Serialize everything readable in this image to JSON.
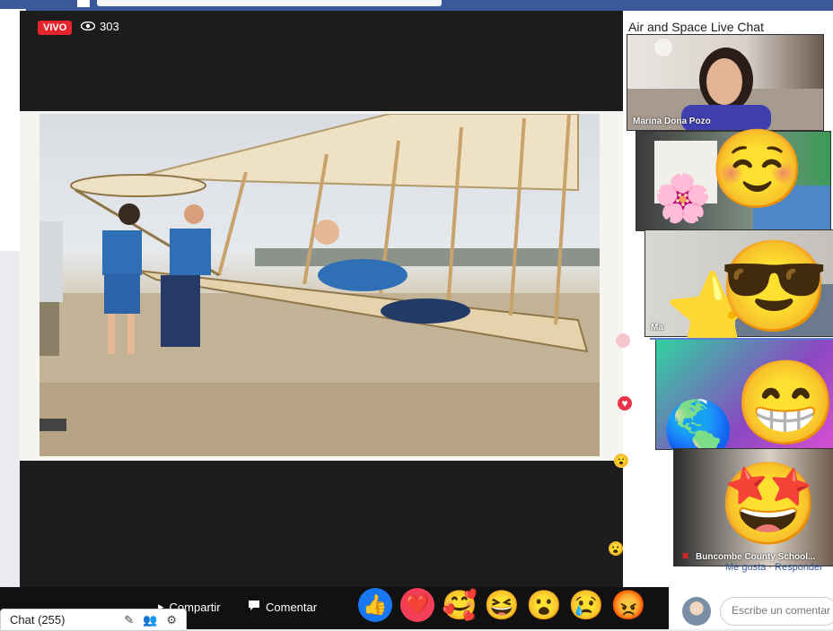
{
  "live": {
    "badge": "VIVO",
    "viewers": "303"
  },
  "chat": {
    "title": "Air and Space Live Chat",
    "participants": [
      {
        "name": "Marina Dona Pozo"
      },
      {
        "name": ""
      },
      {
        "name": "Ma"
      },
      {
        "name": ""
      },
      {
        "name": "Buncombe County School..."
      }
    ],
    "footer_links": "Me gusta · Responder"
  },
  "emojis": {
    "tile2": [
      "🌸",
      "☺️"
    ],
    "tile3": [
      "⭐",
      "😎"
    ],
    "tile4": [
      "🌎",
      "😁"
    ],
    "tile5": [
      "🤩"
    ]
  },
  "actions": {
    "share": "Compartir",
    "comment": "Comentar"
  },
  "reactions": [
    "👍",
    "❤️",
    "🥰",
    "😆",
    "😮",
    "😢",
    "😡"
  ],
  "chatbar": {
    "label": "Chat (255)"
  },
  "comment_box": {
    "placeholder": "Escribe un comentario..."
  },
  "colors": {
    "facebook_blue": "#3b5998",
    "live_red": "#e4262c",
    "like_blue": "#1877f2"
  }
}
